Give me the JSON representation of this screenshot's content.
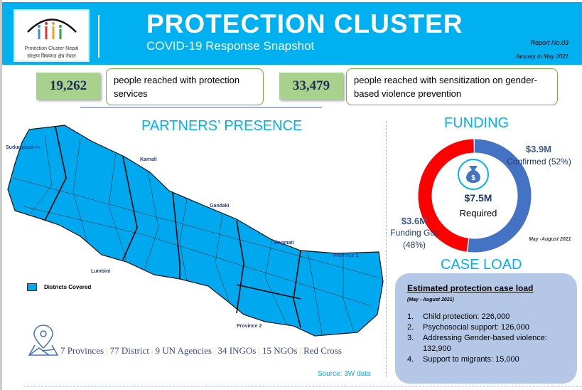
{
  "header": {
    "logo_text_en": "Protection Cluster Nepal",
    "logo_text_np": "संरक्षण विषयगत क्षेत्र नेपाल",
    "title": "PROTECTION CLUSTER",
    "subtitle": "COVID-19 Response Snapshot",
    "report_no": "Report No.09",
    "period": "January to May 2021"
  },
  "stats": [
    {
      "value": "19,262",
      "text": "people reached with protection services"
    },
    {
      "value": "33,479",
      "text": "people reached with sensitization on gender-based violence prevention"
    }
  ],
  "partners": {
    "title": "PARTNERS’ PRESENCE",
    "provinces": [
      "Sudurpaschim",
      "Karnali",
      "Gandaki",
      "Bagmati",
      "Province 1",
      "Province 2",
      "Lumbini"
    ],
    "legend": "Districts Covered",
    "map_color": "#00a9ef",
    "summary": [
      "7 Provinces",
      "77 District",
      "9 UN Agencies",
      "34 INGOs",
      "15 NGOs",
      "Red Cross"
    ],
    "source": "Source: 3W data"
  },
  "funding": {
    "title": "FUNDING",
    "required_value": "$7.5M",
    "required_label": "Required",
    "confirmed_value": "$3.9M",
    "confirmed_label": "Confirmed (52%)",
    "confirmed_pct": 52,
    "gap_value": "$3.6M",
    "gap_label1": "Funding Gap",
    "gap_label2": "(48%)",
    "gap_pct": 48,
    "period": "May -August 2021",
    "confirmed_color": "#4472c4",
    "gap_color": "#ff0000"
  },
  "caseload": {
    "title": "CASE LOAD",
    "box_title": "Estimated protection case load",
    "period": "(May - August 2021)",
    "items": [
      {
        "n": "1.",
        "text": "Child protection: 226,000"
      },
      {
        "n": "2.",
        "text": "Psychosocial support: 126,000"
      },
      {
        "n": "3.",
        "text": "Addressing Gender-based violence: 132,900"
      },
      {
        "n": "4.",
        "text": "Support to migrants: 15,000"
      }
    ]
  }
}
